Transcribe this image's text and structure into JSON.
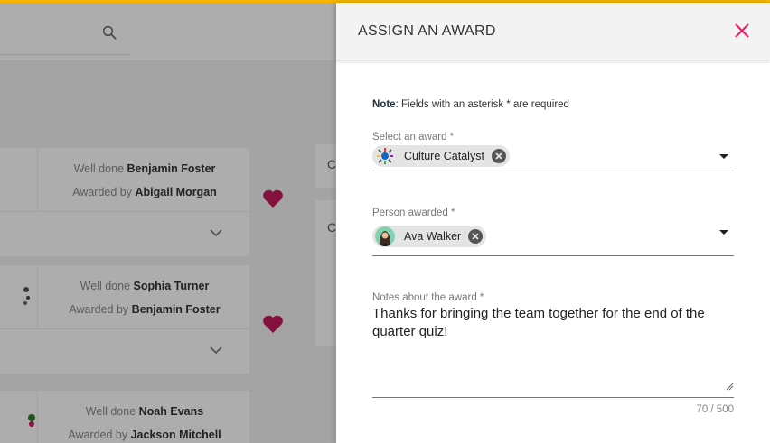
{
  "background": {
    "cards": [
      {
        "well_done_prefix": "Well done",
        "recipient": "Benjamin Foster",
        "awarded_by_prefix": "Awarded by",
        "awarder": "Abigail Morgan"
      },
      {
        "well_done_prefix": "Well done",
        "recipient": "Sophia Turner",
        "awarded_by_prefix": "Awarded by",
        "awarder": "Benjamin Foster"
      },
      {
        "well_done_prefix": "Well done",
        "recipient": "Noah Evans",
        "awarded_by_prefix": "Awarded by",
        "awarder": "Jackson Mitchell"
      }
    ],
    "side_cards": [
      {
        "initial": "C"
      },
      {
        "initial": "C"
      }
    ]
  },
  "drawer": {
    "title": "ASSIGN AN AWARD",
    "note_bold": "Note",
    "note_text": ": Fields with an asterisk * are required",
    "award_field": {
      "label": "Select an award *",
      "chip": "Culture Catalyst"
    },
    "person_field": {
      "label": "Person awarded *",
      "chip": "Ava Walker"
    },
    "notes_field": {
      "label": "Notes about the award *",
      "value": "Thanks for bringing the team together for the end of the quarter quiz!",
      "counter": "70 / 500"
    }
  },
  "colors": {
    "accent_bar": "#f4b400",
    "close_icon": "#e91e63",
    "heart": "#c2185b"
  }
}
